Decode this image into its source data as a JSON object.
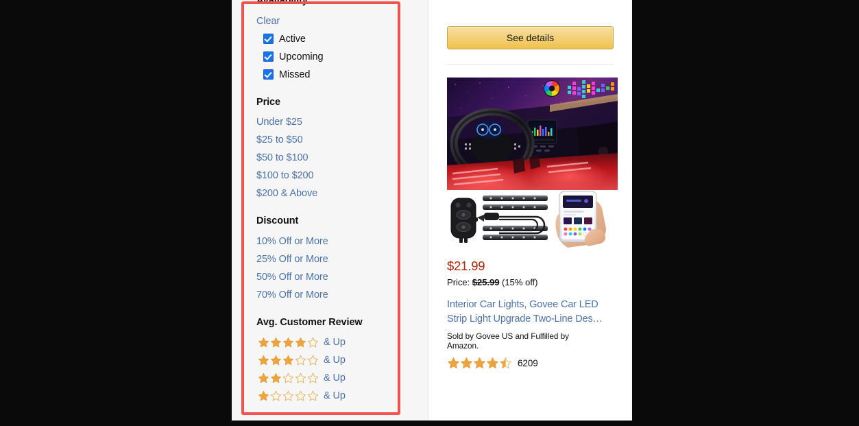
{
  "highlight": {
    "color": "#ef5350",
    "label": "filters-highlight"
  },
  "filters": {
    "availability": {
      "heading": "Availability",
      "clear_label": "Clear",
      "options": [
        {
          "label": "Active",
          "checked": true
        },
        {
          "label": "Upcoming",
          "checked": true
        },
        {
          "label": "Missed",
          "checked": true
        }
      ]
    },
    "price": {
      "heading": "Price",
      "options": [
        "Under $25",
        "$25 to $50",
        "$50 to $100",
        "$100 to $200",
        "$200 & Above"
      ]
    },
    "discount": {
      "heading": "Discount",
      "options": [
        "10% Off or More",
        "25% Off or More",
        "50% Off or More",
        "70% Off or More"
      ]
    },
    "review": {
      "heading": "Avg. Customer Review",
      "suffix": "& Up",
      "options": [
        {
          "stars": 4,
          "label": "& Up"
        },
        {
          "stars": 3,
          "label": "& Up"
        },
        {
          "stars": 2,
          "label": "& Up"
        },
        {
          "stars": 1,
          "label": "& Up"
        }
      ]
    }
  },
  "product_panel": {
    "see_details_label": "See details",
    "image_alt": "car-interior-led-strip-lights-product-photo",
    "price_current": "$21.99",
    "price_prefix": "Price:",
    "price_was": "$25.99",
    "price_discount": "(15% off)",
    "title": "Interior Car Lights, Govee Car LED Strip Light Upgrade Two-Line Des…",
    "sold_by": "Sold by Govee US and Fulfilled by Amazon.",
    "rating_stars": 4.5,
    "review_count": "6209"
  },
  "colors": {
    "link_blue": "#4a72a8",
    "price_red": "#b12704",
    "star_gold": "#f0a33c",
    "button_gold_top": "#f7dfa5",
    "button_gold_bottom": "#f0c14b",
    "checkbox_blue": "#1a73e8",
    "panel_bg": "#f6f6f6"
  }
}
